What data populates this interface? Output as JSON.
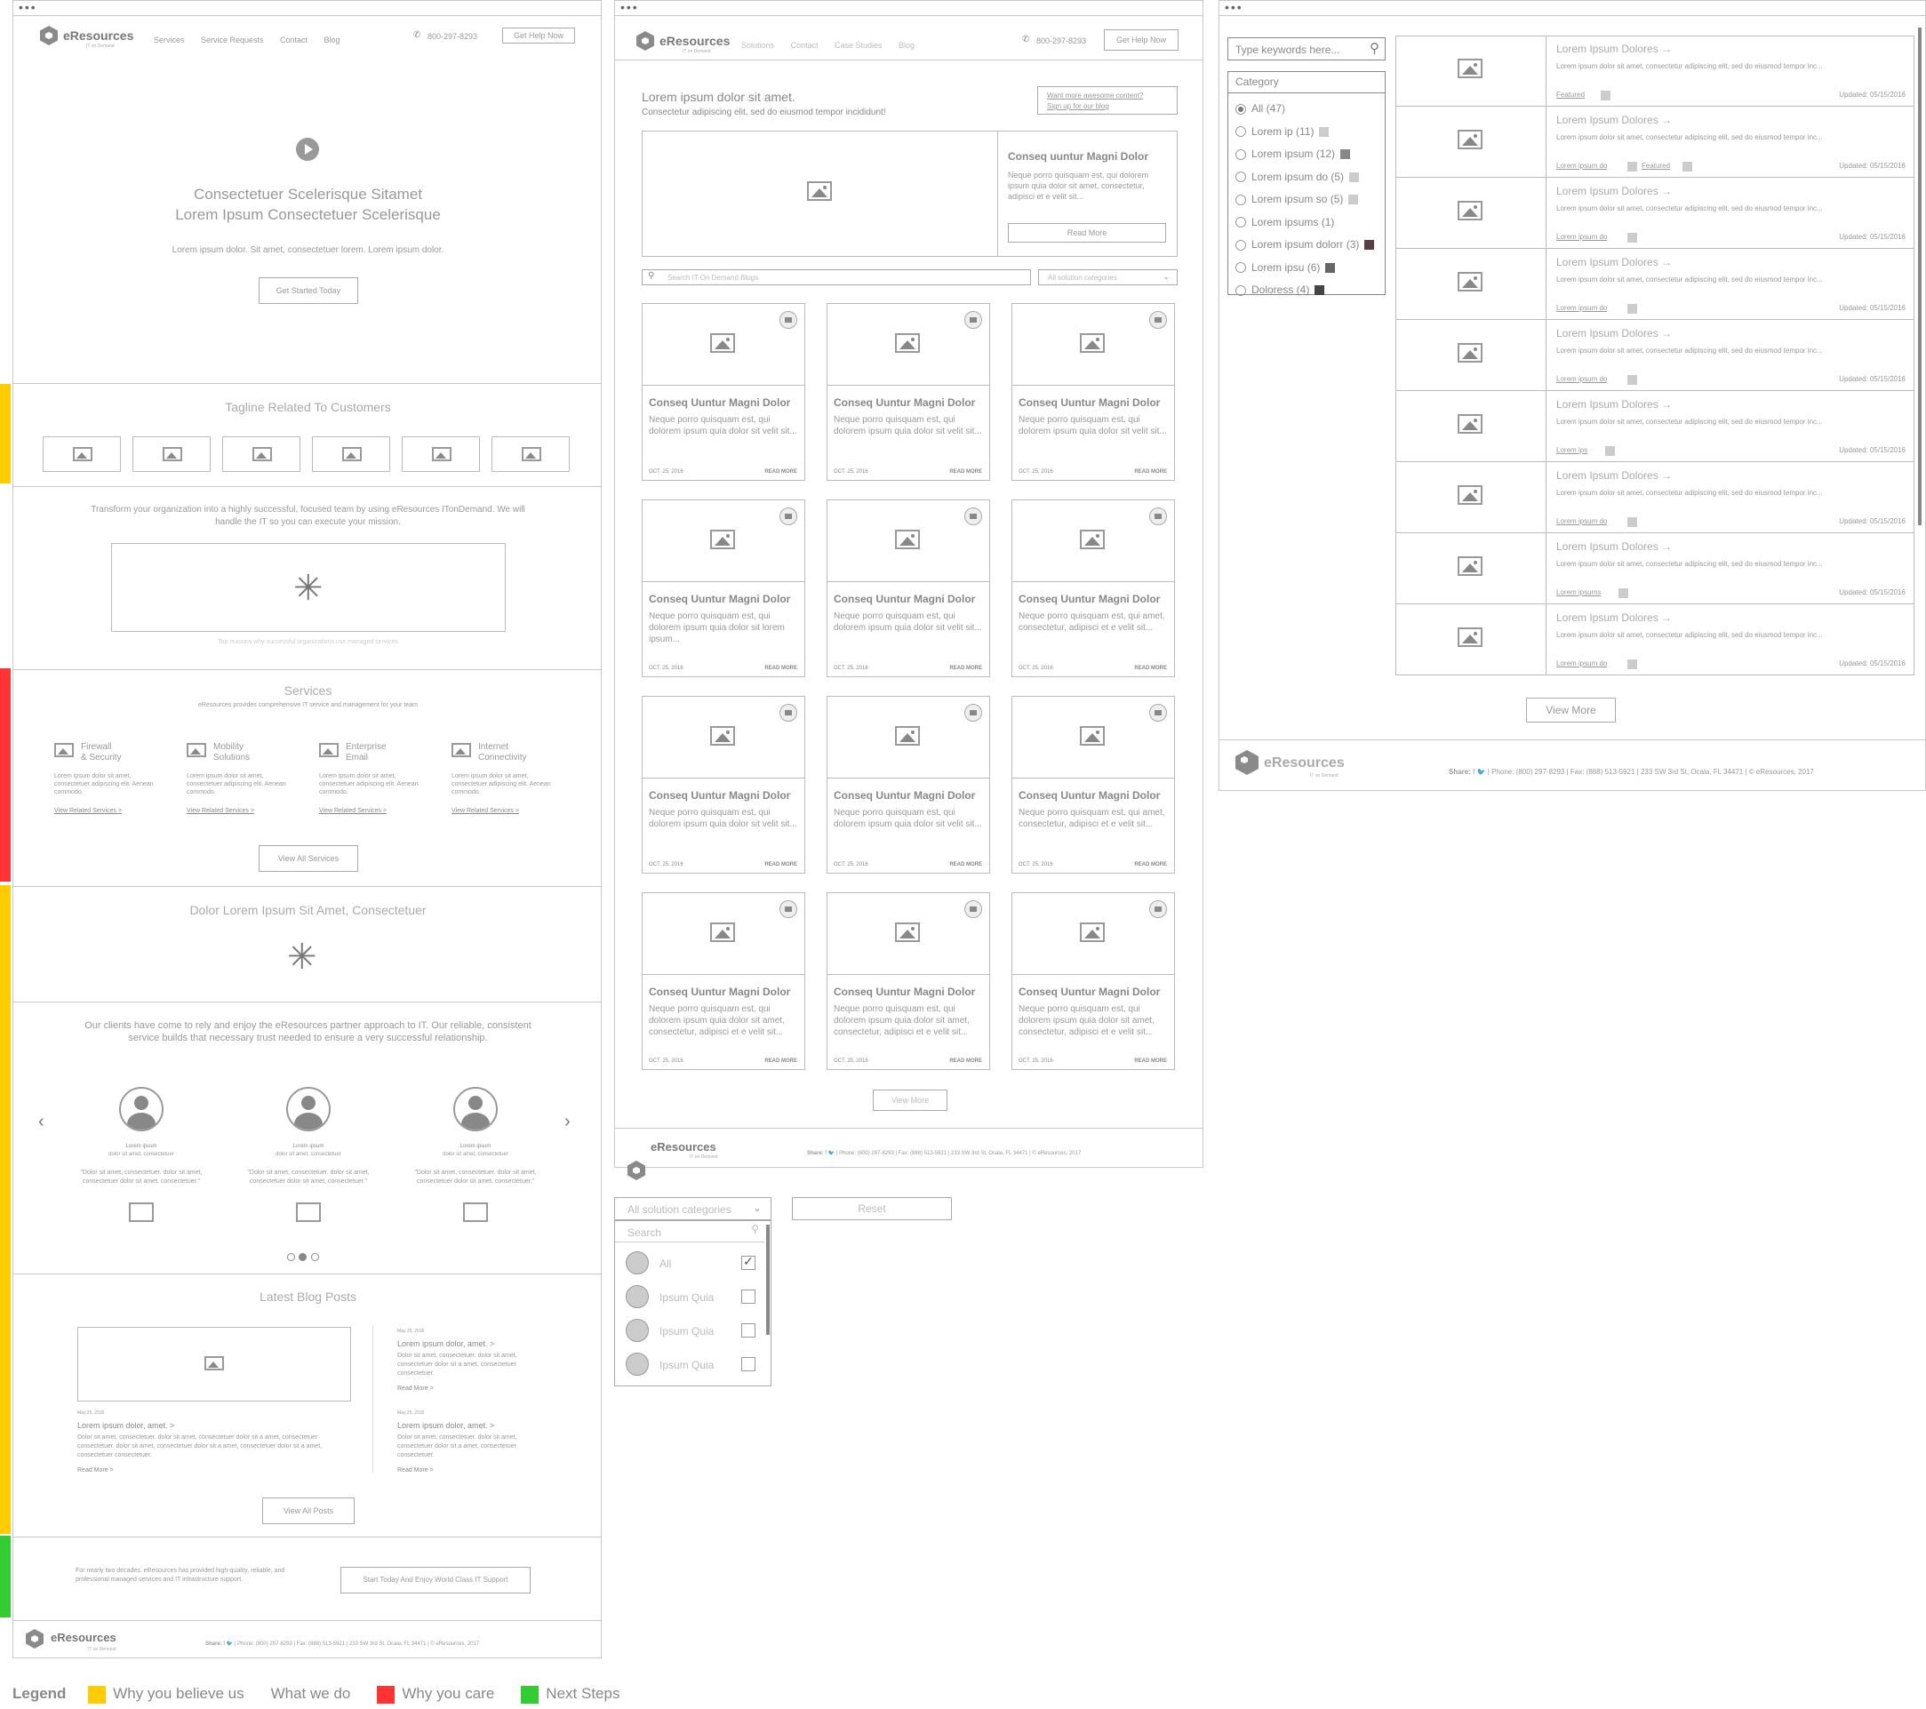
{
  "brand": {
    "name": "eResources",
    "sub": "IT on Demand"
  },
  "w1": {
    "nav": [
      "Services",
      "Service Requests",
      "Contact",
      "Blog"
    ],
    "phone": "800-297-8293",
    "cta": "Get Help Now",
    "hero_line1": "Consectetuer Scelerisque Sitamet",
    "hero_line2": "Lorem Ipsum Consectetuer Scelerisque",
    "hero_sub": "Lorem ipsum dolor. Sit amet, consectetuer lorem. Lorem ipsum dolor.",
    "hero_btn": "Get Started Today",
    "tagline": "Tagline Related To Customers",
    "transform": "Transform your organization into a highly successful, focused team by using eResources ITonDemand.  We will handle the IT so you can execute your mission.",
    "video_caption": "Top reasons why successful organizations use managed services",
    "services_title": "Services",
    "services_sub": "eResources provides comprehensive IT service and management for your team",
    "services": [
      {
        "l1": "Firewall",
        "l2": "& Security",
        "desc": "Lorem ipsum dolor sit amet, consectetuer adipiscing elit. Aenean commodo.",
        "link": "View Related Services >"
      },
      {
        "l1": "Mobility",
        "l2": "Solutions",
        "desc": "Lorem ipsum dolor sit amet, consectetuer adipiscing elit. Aenean commodo.",
        "link": "View Related Services >"
      },
      {
        "l1": "Enterprise",
        "l2": "Email",
        "desc": "Lorem ipsum dolor sit amet, consectetuer adipiscing elit. Aenean commodo.",
        "link": "View Related Services >"
      },
      {
        "l1": "Internet",
        "l2": "Connectivity",
        "desc": "Lorem ipsum dolor sit amet, consectetuer adipiscing elit. Aenean commodo.",
        "link": "View Related Services >"
      }
    ],
    "view_all_services": "View All Services",
    "dolor_title": "Dolor Lorem Ipsum Sit Amet, Consectetuer",
    "clients_text": "Our clients have come to rely and enjoy the eResources partner approach to IT. Our reliable, consistent service builds that necessary trust needed to ensure a very successful relationship.",
    "testimonials": [
      {
        "name": "Lorem ipsum",
        "role": "dolor sit amet, consectetuer",
        "quote": "\"Dolor sit amet, consectetuer. dolor sit amet, consectetuer dolor sit amet, consectetuer.\""
      },
      {
        "name": "Lorem ipsum",
        "role": "dolor sit amet, consectetuer",
        "quote": "\"Dolor sit amet, consectetuer. dolor sit amet, consectetuer dolor sit amet, consectetuer.\""
      },
      {
        "name": "Lorem ipsum",
        "role": "dolor sit amet, consectetuer",
        "quote": "\"Dolor sit amet, consectetuer. dolor sit amet, consectetuer dolor sit amet, consectetuer.\""
      }
    ],
    "blog_title": "Latest Blog Posts",
    "blog_main": {
      "date": "May 25, 2016",
      "title": "Lorem ipsum dolor, amet. >",
      "desc": "Dolor sit amet, consectetuer. dolor sit amet, consectetuer dolor sit a amet, consectetuer consectetuer. dolor sit amet, consectetuer dolor sit a amet, consectetuer dolor sit a amet, consectetuer consectetuer.",
      "more": "Read More >"
    },
    "blog_side": [
      {
        "date": "May 25, 2016",
        "title": "Lorem ipsum dolor, amet. >",
        "desc": "Dolor sit amet, consectetuer. dolor sit amet, consectetuer dolor sit a amet, consectetuer consectetuer.",
        "more": "Read More >"
      },
      {
        "date": "May 25, 2016",
        "title": "Lorem ipsum dolor, amet. >",
        "desc": "Dolor sit amet, consectetuer. dolor sit amet, consectetuer dolor sit a amet, consectetuer consectetuer.",
        "more": "Read More >"
      }
    ],
    "view_all_posts": "View All Posts",
    "next_text": "For nearly two decades, eResources has provided high-quality, reliable, and professional managed services and IT infrastructure support.",
    "next_btn": "Start Today And Enjoy World Class IT Support"
  },
  "footer": {
    "share": "Share:",
    "phone": "Phone: (800) 297-8293",
    "fax": "Fax: (888) 513-5921",
    "address": "233 SW 3rd St, Ocala, FL 34471",
    "copy": "© eResources, 2017"
  },
  "w2": {
    "nav": [
      "Solutions",
      "Contact",
      "Case Studies",
      "Blog"
    ],
    "phone": "800-297-8293",
    "cta": "Get Help Now",
    "intro_title": "Lorem ipsum dolor sit amet.",
    "intro_sub": "Consectetur adipiscing elit, sed do eiusmod tempor incididunt!",
    "promo1": "Want more awesome content?",
    "promo2": "Sign up for our blog",
    "feat_title": "Conseq uuntur Magni Dolor",
    "feat_desc": "Neque porro quisquam est, qui dolorem ipsum quia dolor sit amet, consectetur, adipisci et e velit sit...",
    "feat_btn": "Read More",
    "search_placeholder": "Search IT On Demand Blogs",
    "cat_select": "All solution categories",
    "cards": [
      {
        "title": "Conseq Uuntur Magni Dolor",
        "desc": "Neque porro quisquam est, qui dolorem ipsum quia dolor sit velit sit...",
        "date": "OCT. 25, 2016",
        "more": "READ MORE"
      },
      {
        "title": "Conseq Uuntur Magni Dolor",
        "desc": "Neque porro quisquam est, qui dolorem ipsum quia dolor sit velit sit...",
        "date": "OCT. 25, 2016",
        "more": "READ MORE"
      },
      {
        "title": "Conseq Uuntur Magni Dolor",
        "desc": "Neque porro quisquam est, qui dolorem ipsum quia dolor sit velit sit...",
        "date": "OCT. 25, 2016",
        "more": "READ MORE"
      },
      {
        "title": "Conseq Uuntur Magni Dolor",
        "desc": "Neque porro quisquam est, qui dolorem ipsum quia dolor sit lorem ipsum...",
        "date": "OCT. 25, 2016",
        "more": "READ MORE"
      },
      {
        "title": "Conseq Uuntur Magni Dolor",
        "desc": "Neque porro quisquam est, qui dolorem ipsum quia dolor sit velit sit...",
        "date": "OCT. 25, 2016",
        "more": "READ MORE"
      },
      {
        "title": "Conseq Uuntur Magni Dolor",
        "desc": "Neque porro quisquam est, qui amet, consectetur, adipisci et e velit sit...",
        "date": "OCT. 25, 2016",
        "more": "READ MORE"
      },
      {
        "title": "Conseq Uuntur Magni Dolor",
        "desc": "Neque porro quisquam est, qui dolorem ipsum quia dolor sit velit sit...",
        "date": "OCT. 25, 2016",
        "more": "READ MORE"
      },
      {
        "title": "Conseq Uuntur Magni Dolor",
        "desc": "Neque porro quisquam est, qui dolorem ipsum quia dolor sit velit sit...",
        "date": "OCT. 25, 2016",
        "more": "READ MORE"
      },
      {
        "title": "Conseq Uuntur Magni Dolor",
        "desc": "Neque porro quisquam est, qui amet, consectetur, adipisci et e velit sit...",
        "date": "OCT. 25, 2016",
        "more": "READ MORE"
      },
      {
        "title": "Conseq Uuntur Magni Dolor",
        "desc": "Neque porro quisquam est, qui dolorem ipsum quia dolor sit amet, consectetur, adipisci et e velit sit...",
        "date": "OCT. 25, 2016",
        "more": "READ MORE"
      },
      {
        "title": "Conseq Uuntur Magni Dolor",
        "desc": "Neque porro quisquam est, qui dolorem ipsum quia dolor sit amet, consectetur, adipisci et e velit sit...",
        "date": "OCT. 25, 2016",
        "more": "READ MORE"
      },
      {
        "title": "Conseq Uuntur Magni Dolor",
        "desc": "Neque porro quisquam est, qui dolorem ipsum quia dolor sit amet, consectetur, adipisci et e velit sit...",
        "date": "OCT. 25, 2016",
        "more": "READ MORE"
      }
    ],
    "view_more": "View More"
  },
  "dropdown": {
    "select": "All solution categories",
    "search": "Search",
    "reset": "Reset",
    "items": [
      {
        "label": "All",
        "checked": true
      },
      {
        "label": "Ipsum Quia",
        "checked": false
      },
      {
        "label": "Ipsum Quia",
        "checked": false
      },
      {
        "label": "Ipsum Quia",
        "checked": false
      }
    ]
  },
  "w3": {
    "search_placeholder": "Type keywords here...",
    "category_title": "Category",
    "categories": [
      {
        "label": "All (47)",
        "selected": true,
        "color": ""
      },
      {
        "label": "Lorem ip (11)",
        "selected": false,
        "color": "#cccccc"
      },
      {
        "label": "Lorem ipsum (12)",
        "selected": false,
        "color": "#888888"
      },
      {
        "label": "Lorem ipsum do (5)",
        "selected": false,
        "color": "#cccccc"
      },
      {
        "label": "Lorem ipsum so (5)",
        "selected": false,
        "color": "#cccccc"
      },
      {
        "label": "Lorem ipsums (1)",
        "selected": false,
        "color": ""
      },
      {
        "label": "Lorem ipsum dolorr (3)",
        "selected": false,
        "color": "#5a4040"
      },
      {
        "label": "Lorem ipsu (6)",
        "selected": false,
        "color": "#666666"
      },
      {
        "label": "Doloress (4)",
        "selected": false,
        "color": "#444444"
      }
    ],
    "rows": [
      {
        "title": "Lorem Ipsum Dolores →",
        "desc": "Lorem ipsum dolor sit amet, consectetur adipiscing elit, sed do eiusmod tempor inc...",
        "tag": "Featured",
        "tag2": "",
        "updated": "Updated: 05/15/2016"
      },
      {
        "title": "Lorem Ipsum Dolores →",
        "desc": "Lorem ipsum dolor sit amet, consectetur adipiscing elit, sed do eiusmod tempor inc...",
        "tag": "Lorem ipsum do",
        "tag2": "Featured",
        "updated": "Updated: 05/15/2016"
      },
      {
        "title": "Lorem Ipsum Dolores →",
        "desc": "Lorem ipsum dolor sit amet, consectetur adipiscing elit, sed do eiusmod tempor inc...",
        "tag": "Lorem ipsum do",
        "tag2": "",
        "updated": "Updated: 05/15/2016"
      },
      {
        "title": "Lorem Ipsum Dolores →",
        "desc": "Lorem ipsum dolor sit amet, consectetur adipiscing elit, sed do eiusmod tempor inc...",
        "tag": "Lorem ipsum do",
        "tag2": "",
        "updated": "Updated: 05/15/2016"
      },
      {
        "title": "Lorem Ipsum Dolores →",
        "desc": "Lorem ipsum dolor sit amet, consectetur adipiscing elit, sed do eiusmod tempor inc...",
        "tag": "Lorem ipsum do",
        "tag2": "",
        "updated": "Updated: 05/15/2016"
      },
      {
        "title": "Lorem Ipsum Dolores →",
        "desc": "Lorem ipsum dolor sit amet, consectetur adipiscing elit, sed do eiusmod tempor inc...",
        "tag": "Lorem ips",
        "tag2": "",
        "updated": "Updated: 05/15/2016"
      },
      {
        "title": "Lorem Ipsum Dolores →",
        "desc": "Lorem ipsum dolor sit amet, consectetur adipiscing elit, sed do eiusmod tempor inc...",
        "tag": "Lorem ipsum do",
        "tag2": "",
        "updated": "Updated: 05/15/2016"
      },
      {
        "title": "Lorem Ipsum Dolores →",
        "desc": "Lorem ipsum dolor sit amet, consectetur adipiscing elit, sed do eiusmod tempor inc...",
        "tag": "Lorem ipsums",
        "tag2": "",
        "updated": "Updated: 05/15/2016"
      },
      {
        "title": "Lorem Ipsum Dolores →",
        "desc": "Lorem ipsum dolor sit amet, consectetur adipiscing elit, sed do eiusmod tempor inc...",
        "tag": "Lorem ipsum do",
        "tag2": "",
        "updated": "Updated: 05/15/2016"
      }
    ],
    "view_more": "View More"
  },
  "legend": {
    "title": "Legend",
    "items": [
      {
        "label": "Why you believe us",
        "color": "#ffcc00"
      },
      {
        "label": "What we do",
        "color": ""
      },
      {
        "label": "Why you care",
        "color": "#ff3333"
      },
      {
        "label": "Next Steps",
        "color": "#33cc33"
      }
    ]
  }
}
